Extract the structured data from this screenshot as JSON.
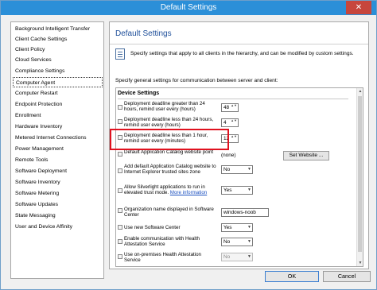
{
  "window": {
    "title": "Default Settings",
    "close_glyph": "✕"
  },
  "sidebar": {
    "items": [
      {
        "label": "Background Intelligent Transfer",
        "selected": false
      },
      {
        "label": "Client Cache Settings",
        "selected": false
      },
      {
        "label": "Client Policy",
        "selected": false
      },
      {
        "label": "Cloud Services",
        "selected": false
      },
      {
        "label": "Compliance Settings",
        "selected": false
      },
      {
        "label": "Computer Agent",
        "selected": true
      },
      {
        "label": "Computer Restart",
        "selected": false
      },
      {
        "label": "Endpoint Protection",
        "selected": false
      },
      {
        "label": "Enrollment",
        "selected": false
      },
      {
        "label": "Hardware Inventory",
        "selected": false
      },
      {
        "label": "Metered Internet Connections",
        "selected": false
      },
      {
        "label": "Power Management",
        "selected": false
      },
      {
        "label": "Remote Tools",
        "selected": false
      },
      {
        "label": "Software Deployment",
        "selected": false
      },
      {
        "label": "Software Inventory",
        "selected": false
      },
      {
        "label": "Software Metering",
        "selected": false
      },
      {
        "label": "Software Updates",
        "selected": false
      },
      {
        "label": "State Messaging",
        "selected": false
      },
      {
        "label": "User and Device Affinity",
        "selected": false
      }
    ]
  },
  "panel": {
    "title": "Default Settings",
    "description": "Specify settings that apply to all clients in the hierarchy, and can be modified by custom settings.",
    "intro": "Specify general settings for communication between server and client:",
    "group_header": "Device Settings",
    "settings": {
      "s1": {
        "label": "Deployment deadline greater than 24 hours, remind user every (hours)",
        "value": "48",
        "type": "spinner"
      },
      "s2": {
        "label": "Deployment deadline less than 24 hours, remind user every (hours)",
        "value": "4",
        "type": "spinner"
      },
      "s3": {
        "label": "Deployment deadline less than 1 hour, remind user every (minutes)",
        "value": "12",
        "type": "spinner"
      },
      "s4": {
        "label": "Default Application Catalog website point",
        "value": "(none)",
        "button": "Set Website ..."
      },
      "s5": {
        "label": "Add default Application Catalog website to Internet Explorer trusted sites zone",
        "value": "No",
        "type": "dropdown"
      },
      "s6": {
        "label_pre": "Allow Silverlight applications to run in elevated trust mode.",
        "link": "More information",
        "value": "Yes",
        "type": "dropdown"
      },
      "s7": {
        "label": "Organization name displayed in Software Center",
        "value": "windows-noob",
        "type": "text"
      },
      "s8": {
        "label": "Use new Software Center",
        "value": "Yes",
        "type": "dropdown"
      },
      "s9": {
        "label": "Enable communication with Health Attestation Service",
        "value": "No",
        "type": "dropdown"
      },
      "s10": {
        "label": "Use on-premises Health Attestation Service",
        "value": "No",
        "type": "dropdown",
        "disabled": true
      }
    }
  },
  "footer": {
    "ok": "OK",
    "cancel": "Cancel"
  },
  "colors": {
    "titlebar": "#2b8fd8",
    "close": "#c7463d",
    "highlight": "#e0121f",
    "heading": "#1e4f9a",
    "link": "#1a4fbf"
  },
  "icons": {
    "spinner": "▲▼",
    "dropdown": "▼",
    "scroll_up": "▲",
    "scroll_down": "▼"
  }
}
